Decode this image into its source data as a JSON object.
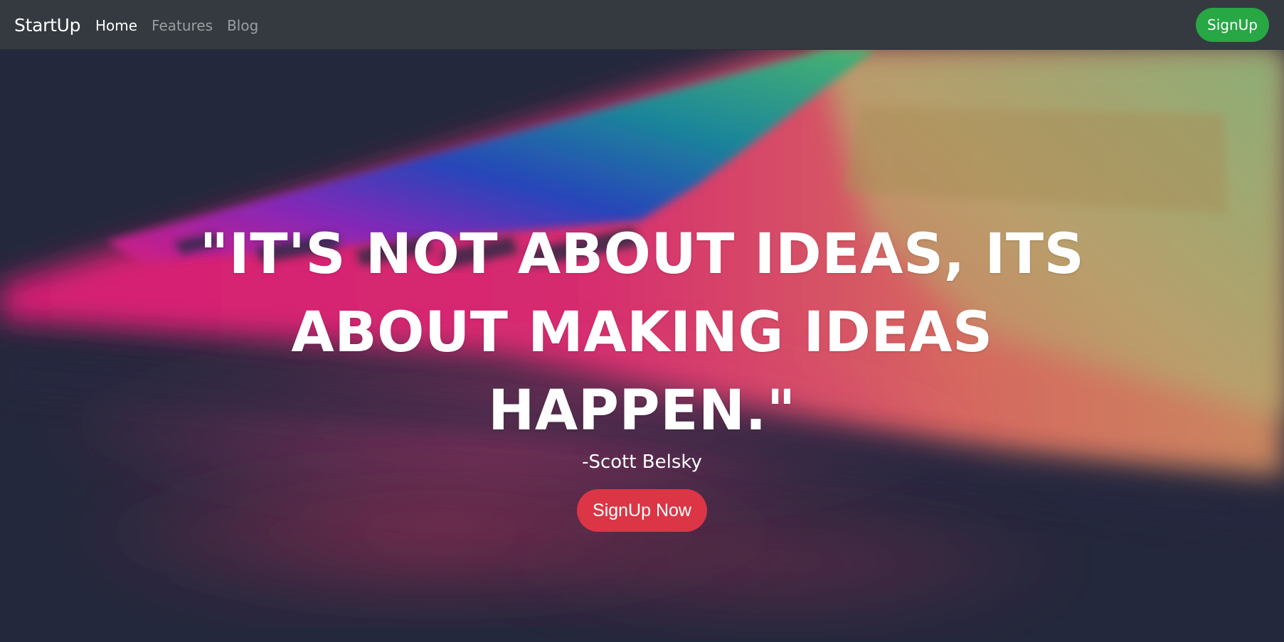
{
  "navbar": {
    "brand": "StartUp",
    "links": [
      {
        "label": "Home",
        "active": true
      },
      {
        "label": "Features",
        "active": false
      },
      {
        "label": "Blog",
        "active": false
      }
    ],
    "signup_label": "SignUp"
  },
  "hero": {
    "quote_lines": [
      "\"IT'S NOT ABOUT IDEAS, ITS",
      "ABOUT MAKING IDEAS",
      "HAPPEN.\""
    ],
    "author": "-Scott Belsky",
    "cta_label": "SignUp Now"
  },
  "colors": {
    "navbar_bg": "#343a40",
    "signup_green": "#28a745",
    "cta_red": "#dc3545",
    "hero_dark": "#272b3f",
    "accent_pink": "#ff2d7a",
    "accent_blue": "#2b5cff",
    "accent_green": "#3fd18a",
    "accent_yellow": "#e6d77a"
  }
}
